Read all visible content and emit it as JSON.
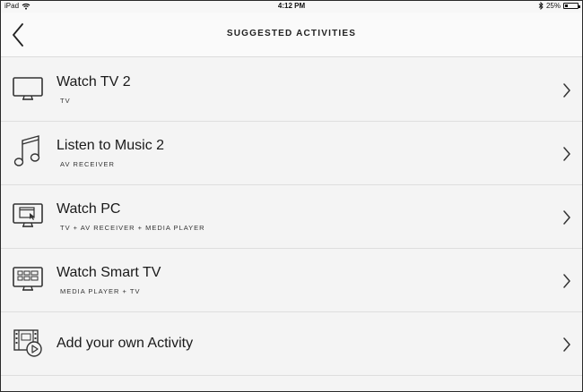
{
  "status": {
    "device": "iPad",
    "time": "4:12 PM",
    "battery": "25%",
    "battery_level": 0.25
  },
  "header": {
    "title": "SUGGESTED ACTIVITIES"
  },
  "activities": [
    {
      "title": "Watch TV 2",
      "subtitle": "TV",
      "icon": "tv-icon"
    },
    {
      "title": "Listen to Music 2",
      "subtitle": "AV RECEIVER",
      "icon": "music-note-icon"
    },
    {
      "title": "Watch PC",
      "subtitle": "TV + AV RECEIVER + MEDIA PLAYER",
      "icon": "pc-monitor-icon"
    },
    {
      "title": "Watch Smart TV",
      "subtitle": "MEDIA PLAYER + TV",
      "icon": "smart-tv-icon"
    },
    {
      "title": "Add your own Activity",
      "subtitle": "",
      "icon": "film-add-icon"
    }
  ]
}
